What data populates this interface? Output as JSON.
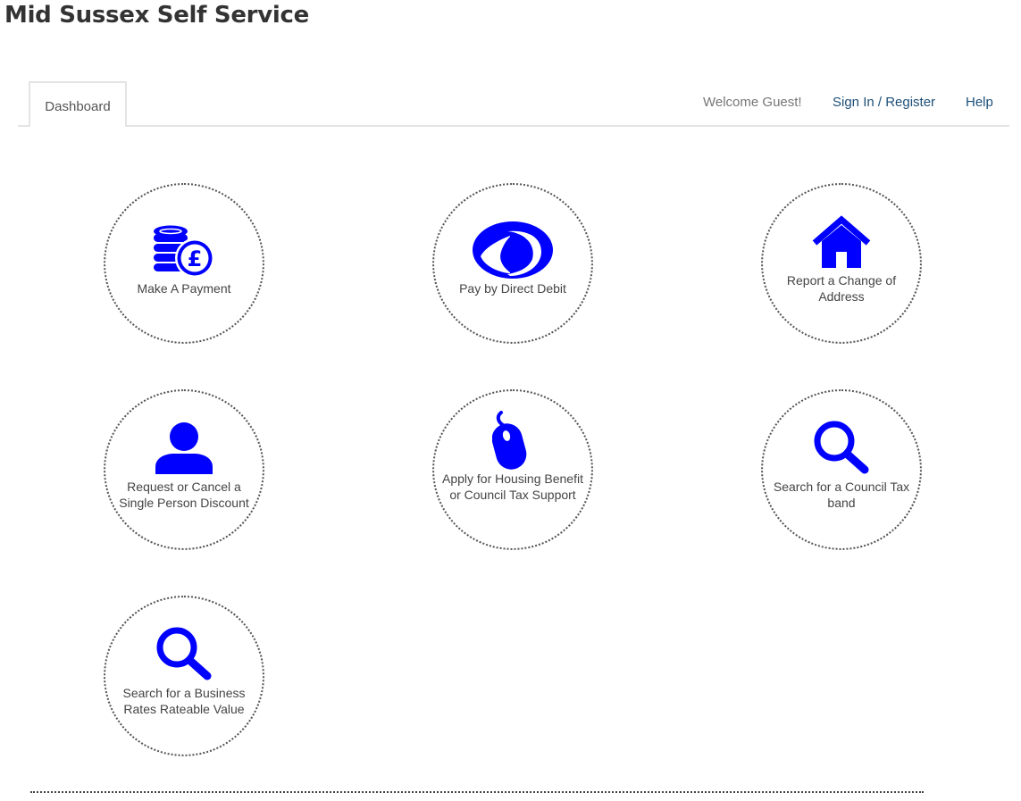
{
  "header": {
    "title": "Mid Sussex Self Service"
  },
  "nav": {
    "tabs": [
      {
        "label": "Dashboard",
        "active": true
      }
    ],
    "welcome": "Welcome Guest!",
    "sign_in_label": "Sign In / Register",
    "help_label": "Help"
  },
  "theme": {
    "icon_color": "#0000ff",
    "link_color": "#1d4f78"
  },
  "tiles": [
    {
      "label": "Make A Payment",
      "icon": "coins-pound-icon"
    },
    {
      "label": "Pay by Direct Debit",
      "icon": "direct-debit-icon"
    },
    {
      "label": "Report a Change of Address",
      "icon": "house-icon"
    },
    {
      "label": "Request or Cancel a Single Person Discount",
      "icon": "person-icon"
    },
    {
      "label": "Apply for Housing Benefit or Council Tax Support",
      "icon": "mouse-icon"
    },
    {
      "label": "Search for a Council Tax band",
      "icon": "magnifier-icon"
    },
    {
      "label": "Search for a Business Rates Rateable Value",
      "icon": "magnifier-icon"
    }
  ]
}
